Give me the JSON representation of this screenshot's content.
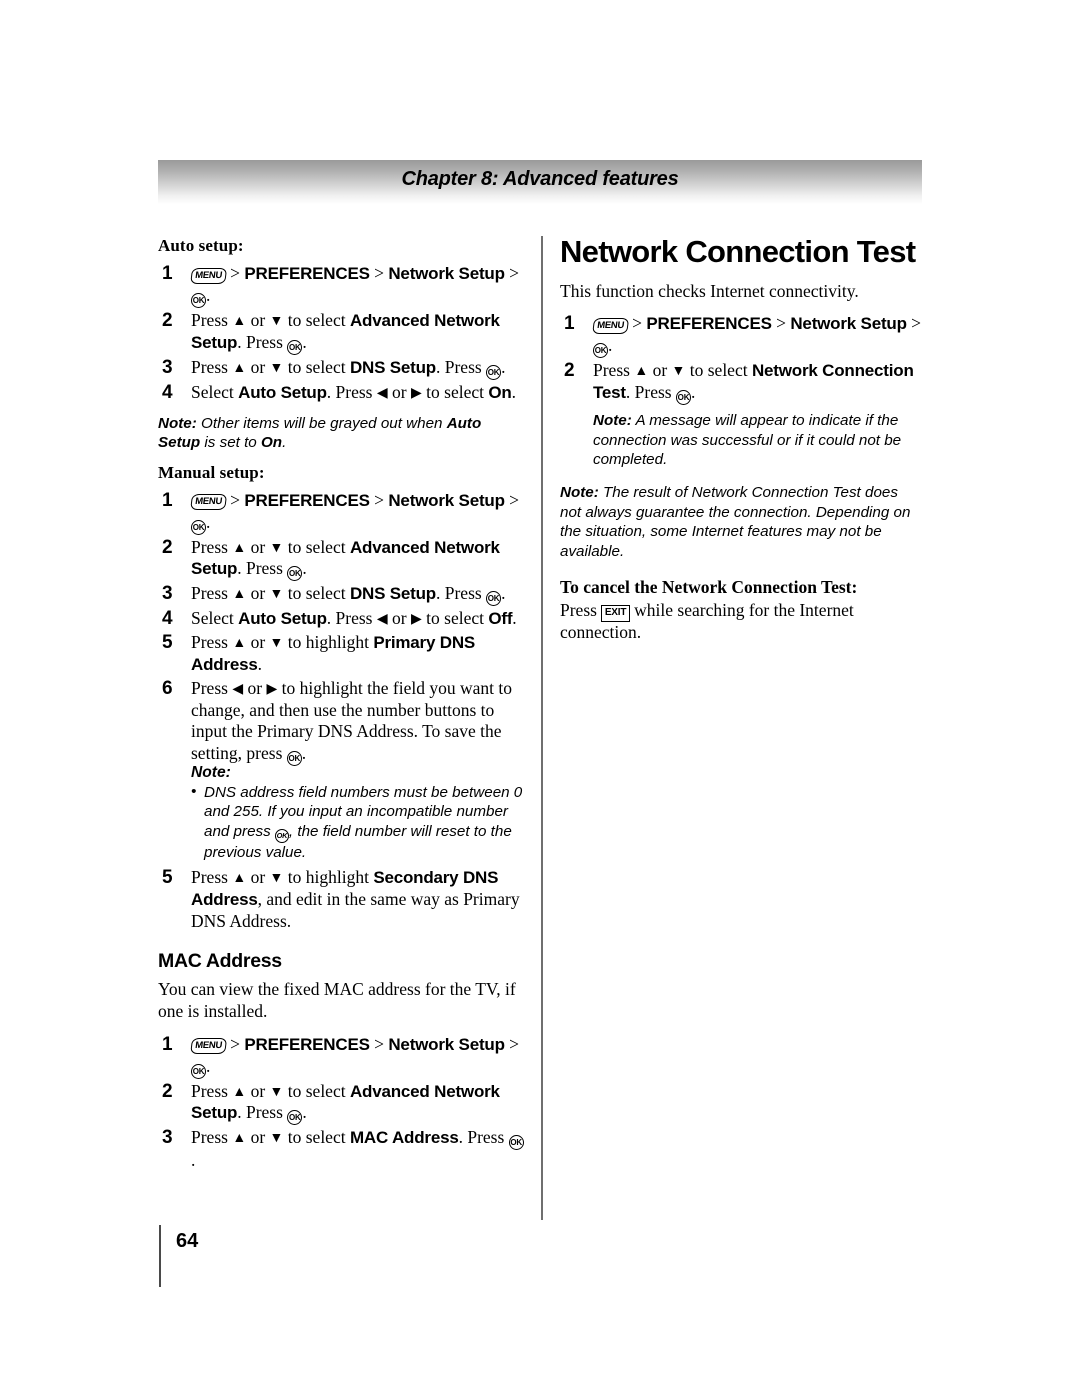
{
  "header": {
    "chapter_title": "Chapter 8: Advanced features"
  },
  "icons": {
    "menu": "MENU",
    "ok": "OK",
    "exit": "EXIT",
    "up_arrow": "▲",
    "down_arrow": "▼",
    "left_arrow": "◀",
    "right_arrow": "▶",
    "gt": ">"
  },
  "left_column": {
    "auto_setup": {
      "label": "Auto setup:",
      "steps": [
        {
          "parts": [
            {
              "t": "icon",
              "v": "menu"
            },
            {
              "t": "gt"
            },
            {
              "t": "bold",
              "v": "PREFERENCES"
            },
            {
              "t": "gt"
            },
            {
              "t": "bold",
              "v": "Network Setup"
            },
            {
              "t": "gt"
            },
            {
              "t": "icon",
              "v": "ok"
            },
            {
              "t": "plain",
              "v": "."
            }
          ]
        },
        {
          "parts": [
            {
              "t": "plain",
              "v": "Press "
            },
            {
              "t": "arrow",
              "v": "up_arrow"
            },
            {
              "t": "plain",
              "v": " or "
            },
            {
              "t": "arrow",
              "v": "down_arrow"
            },
            {
              "t": "plain",
              "v": " to select "
            },
            {
              "t": "bold",
              "v": "Advanced Network Setup"
            },
            {
              "t": "plain",
              "v": ". Press "
            },
            {
              "t": "icon",
              "v": "ok"
            },
            {
              "t": "plain",
              "v": "."
            }
          ]
        },
        {
          "parts": [
            {
              "t": "plain",
              "v": "Press "
            },
            {
              "t": "arrow",
              "v": "up_arrow"
            },
            {
              "t": "plain",
              "v": " or "
            },
            {
              "t": "arrow",
              "v": "down_arrow"
            },
            {
              "t": "plain",
              "v": " to select "
            },
            {
              "t": "bold",
              "v": "DNS Setup"
            },
            {
              "t": "plain",
              "v": ". Press "
            },
            {
              "t": "icon",
              "v": "ok"
            },
            {
              "t": "plain",
              "v": "."
            }
          ]
        },
        {
          "parts": [
            {
              "t": "plain",
              "v": "Select "
            },
            {
              "t": "bold",
              "v": "Auto Setup"
            },
            {
              "t": "plain",
              "v": ". Press "
            },
            {
              "t": "arrow",
              "v": "left_arrow"
            },
            {
              "t": "plain",
              "v": " or "
            },
            {
              "t": "arrow",
              "v": "right_arrow"
            },
            {
              "t": "plain",
              "v": " to select "
            },
            {
              "t": "bold",
              "v": "On"
            },
            {
              "t": "plain",
              "v": "."
            }
          ]
        }
      ],
      "note": {
        "label": "Note:",
        "parts": [
          {
            "t": "plain",
            "v": " Other items will be grayed out when "
          },
          {
            "t": "bold",
            "v": "Auto Setup"
          },
          {
            "t": "plain",
            "v": " is set to "
          },
          {
            "t": "bold",
            "v": "On"
          },
          {
            "t": "plain",
            "v": "."
          }
        ]
      }
    },
    "manual_setup": {
      "label": "Manual setup:",
      "steps": [
        {
          "parts": [
            {
              "t": "icon",
              "v": "menu"
            },
            {
              "t": "gt"
            },
            {
              "t": "bold",
              "v": "PREFERENCES"
            },
            {
              "t": "gt"
            },
            {
              "t": "bold",
              "v": "Network Setup"
            },
            {
              "t": "gt"
            },
            {
              "t": "icon",
              "v": "ok"
            },
            {
              "t": "plain",
              "v": "."
            }
          ]
        },
        {
          "parts": [
            {
              "t": "plain",
              "v": "Press "
            },
            {
              "t": "arrow",
              "v": "up_arrow"
            },
            {
              "t": "plain",
              "v": " or "
            },
            {
              "t": "arrow",
              "v": "down_arrow"
            },
            {
              "t": "plain",
              "v": " to select "
            },
            {
              "t": "bold",
              "v": "Advanced Network Setup"
            },
            {
              "t": "plain",
              "v": ". Press "
            },
            {
              "t": "icon",
              "v": "ok"
            },
            {
              "t": "plain",
              "v": "."
            }
          ]
        },
        {
          "parts": [
            {
              "t": "plain",
              "v": "Press "
            },
            {
              "t": "arrow",
              "v": "up_arrow"
            },
            {
              "t": "plain",
              "v": " or "
            },
            {
              "t": "arrow",
              "v": "down_arrow"
            },
            {
              "t": "plain",
              "v": " to select "
            },
            {
              "t": "bold",
              "v": "DNS Setup"
            },
            {
              "t": "plain",
              "v": ". Press "
            },
            {
              "t": "icon",
              "v": "ok"
            },
            {
              "t": "plain",
              "v": "."
            }
          ]
        },
        {
          "parts": [
            {
              "t": "plain",
              "v": "Select "
            },
            {
              "t": "bold",
              "v": "Auto Setup"
            },
            {
              "t": "plain",
              "v": ". Press "
            },
            {
              "t": "arrow",
              "v": "left_arrow"
            },
            {
              "t": "plain",
              "v": " or "
            },
            {
              "t": "arrow",
              "v": "right_arrow"
            },
            {
              "t": "plain",
              "v": " to select "
            },
            {
              "t": "bold",
              "v": "Off"
            },
            {
              "t": "plain",
              "v": "."
            }
          ]
        },
        {
          "parts": [
            {
              "t": "plain",
              "v": "Press "
            },
            {
              "t": "arrow",
              "v": "up_arrow"
            },
            {
              "t": "plain",
              "v": " or "
            },
            {
              "t": "arrow",
              "v": "down_arrow"
            },
            {
              "t": "plain",
              "v": " to highlight "
            },
            {
              "t": "bold",
              "v": "Primary DNS Address"
            },
            {
              "t": "plain",
              "v": "."
            }
          ]
        },
        {
          "parts": [
            {
              "t": "plain",
              "v": "Press "
            },
            {
              "t": "arrow",
              "v": "left_arrow"
            },
            {
              "t": "plain",
              "v": " or "
            },
            {
              "t": "arrow",
              "v": "right_arrow"
            },
            {
              "t": "plain",
              "v": " to highlight the field you want to change, and then use the number buttons to input the Primary DNS Address. To save the setting, press "
            },
            {
              "t": "icon",
              "v": "ok"
            },
            {
              "t": "plain",
              "v": "."
            }
          ]
        }
      ],
      "step6_note_label": "Note:",
      "step6_bullet": {
        "parts": [
          {
            "t": "plain",
            "v": "DNS address field numbers must be between 0 and 255. If you input an incompatible number and press "
          },
          {
            "t": "icon",
            "v": "ok"
          },
          {
            "t": "plain",
            "v": ", the field number will reset to the previous value."
          }
        ]
      },
      "step7": {
        "parts": [
          {
            "t": "plain",
            "v": "Press "
          },
          {
            "t": "arrow",
            "v": "up_arrow"
          },
          {
            "t": "plain",
            "v": " or "
          },
          {
            "t": "arrow",
            "v": "down_arrow"
          },
          {
            "t": "plain",
            "v": " to highlight "
          },
          {
            "t": "bold",
            "v": "Secondary DNS Address"
          },
          {
            "t": "plain",
            "v": ", and edit in the same way as Primary DNS Address."
          }
        ]
      }
    },
    "mac_address": {
      "heading": "MAC Address",
      "intro": "You can view the fixed MAC address for the TV, if one is installed.",
      "steps": [
        {
          "parts": [
            {
              "t": "icon",
              "v": "menu"
            },
            {
              "t": "gt"
            },
            {
              "t": "bold",
              "v": "PREFERENCES"
            },
            {
              "t": "gt"
            },
            {
              "t": "bold",
              "v": "Network Setup"
            },
            {
              "t": "gt"
            },
            {
              "t": "icon",
              "v": "ok"
            },
            {
              "t": "plain",
              "v": "."
            }
          ]
        },
        {
          "parts": [
            {
              "t": "plain",
              "v": "Press "
            },
            {
              "t": "arrow",
              "v": "up_arrow"
            },
            {
              "t": "plain",
              "v": " or "
            },
            {
              "t": "arrow",
              "v": "down_arrow"
            },
            {
              "t": "plain",
              "v": " to select "
            },
            {
              "t": "bold",
              "v": "Advanced Network Setup"
            },
            {
              "t": "plain",
              "v": ". Press "
            },
            {
              "t": "icon",
              "v": "ok"
            },
            {
              "t": "plain",
              "v": "."
            }
          ]
        },
        {
          "parts": [
            {
              "t": "plain",
              "v": "Press "
            },
            {
              "t": "arrow",
              "v": "up_arrow"
            },
            {
              "t": "plain",
              "v": " or "
            },
            {
              "t": "arrow",
              "v": "down_arrow"
            },
            {
              "t": "plain",
              "v": " to select "
            },
            {
              "t": "bold",
              "v": "MAC Address"
            },
            {
              "t": "plain",
              "v": ". Press "
            },
            {
              "t": "icon",
              "v": "ok"
            },
            {
              "t": "plain",
              "v": "."
            }
          ]
        }
      ]
    }
  },
  "right_column": {
    "heading": "Network Connection Test",
    "intro": "This function checks Internet connectivity.",
    "steps": [
      {
        "parts": [
          {
            "t": "icon",
            "v": "menu"
          },
          {
            "t": "gt"
          },
          {
            "t": "bold",
            "v": "PREFERENCES"
          },
          {
            "t": "gt"
          },
          {
            "t": "bold",
            "v": "Network Setup"
          },
          {
            "t": "gt"
          },
          {
            "t": "icon",
            "v": "ok"
          },
          {
            "t": "plain",
            "v": "."
          }
        ]
      },
      {
        "parts": [
          {
            "t": "plain",
            "v": "Press "
          },
          {
            "t": "arrow",
            "v": "up_arrow"
          },
          {
            "t": "plain",
            "v": " or "
          },
          {
            "t": "arrow",
            "v": "down_arrow"
          },
          {
            "t": "plain",
            "v": " to select "
          },
          {
            "t": "bold",
            "v": "Network Connection Test"
          },
          {
            "t": "plain",
            "v": ". Press "
          },
          {
            "t": "icon",
            "v": "ok"
          },
          {
            "t": "plain",
            "v": "."
          }
        ]
      }
    ],
    "step_note": {
      "label": "Note:",
      "text": " A message will appear to indicate if the connection was successful or if it could not be completed."
    },
    "note": {
      "label": "Note:",
      "text": " The result of Network Connection Test does not always guarantee the connection. Depending on the situation, some Internet features may not be available."
    },
    "cancel": {
      "heading": "To cancel the Network Connection Test:",
      "parts": [
        {
          "t": "plain",
          "v": "Press "
        },
        {
          "t": "icon",
          "v": "exit"
        },
        {
          "t": "plain",
          "v": " while searching for the Internet connection."
        }
      ]
    }
  },
  "footer": {
    "page_number": "64"
  }
}
